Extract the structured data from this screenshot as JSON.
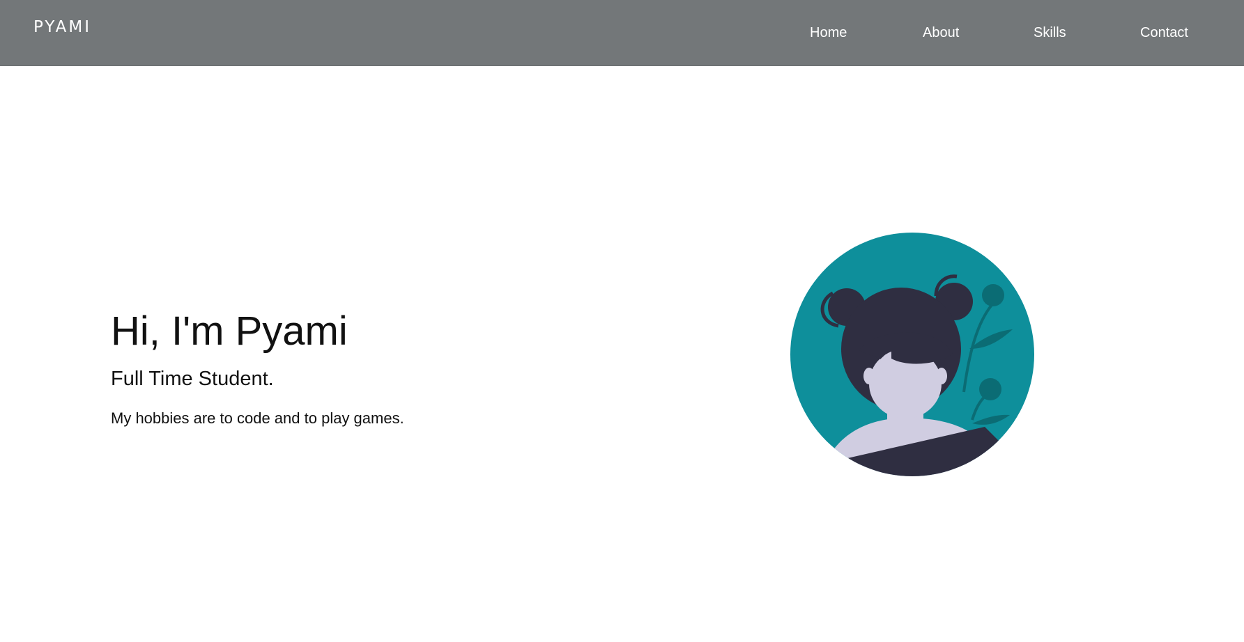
{
  "navbar": {
    "brand": "PYAMI",
    "links": [
      {
        "label": "Home"
      },
      {
        "label": "About"
      },
      {
        "label": "Skills"
      },
      {
        "label": "Contact"
      }
    ]
  },
  "hero": {
    "title": "Hi, I'm Pyami",
    "subtitle": "Full Time Student.",
    "description": "My hobbies are to code and to play games."
  },
  "colors": {
    "navbar_bg": "#737779",
    "text": "#111111",
    "avatar_bg": "#0e8f9b",
    "hair": "#2f2e41",
    "skin": "#d0cde1",
    "foliage": "#0b6c74"
  },
  "icons": {
    "avatar": "girl-avatar-illustration"
  }
}
